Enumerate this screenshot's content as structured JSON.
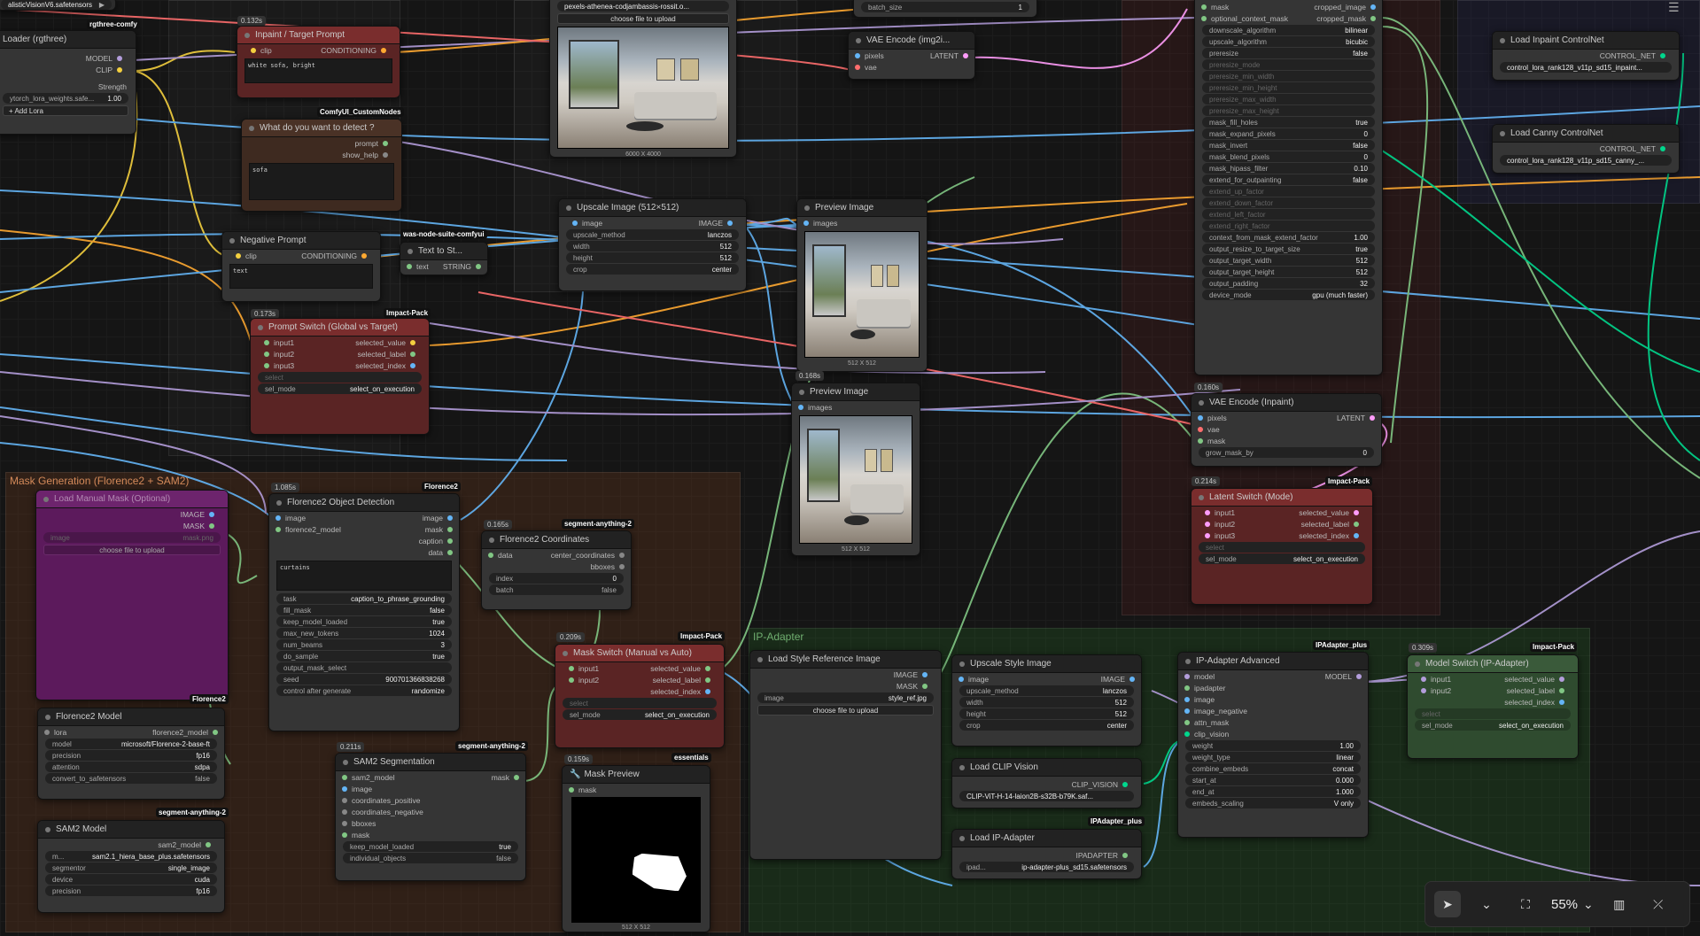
{
  "canvas": {
    "zoom": "55%"
  },
  "groups": {
    "mask_generation": "Mask Generation (Florence2 + SAM2)",
    "ip_adapter": "IP-Adapter"
  },
  "nodes": {
    "ckpt": {
      "value": "alisticVisionV6.safetensors"
    },
    "lora_loader": {
      "title": "Loader (rgthree)",
      "badge": "rgthree-comfy",
      "out_model": "MODEL",
      "out_clip": "CLIP",
      "strength_label": "Strength",
      "lora_name": "ytorch_lora_weights.safe...",
      "lora_strength": "1.00",
      "add_lora": "+ Add Lora"
    },
    "inpaint_prompt": {
      "time": "0.132s",
      "title": "Inpaint / Target Prompt",
      "in_clip": "clip",
      "out": "CONDITIONING",
      "text": "white sofa, bright",
      "badge": "ComfyUI_CustomNodes"
    },
    "detect_prompt": {
      "title": "What do you want to detect ?",
      "out_prompt": "prompt",
      "out_help": "show_help",
      "text": "sofa"
    },
    "negative": {
      "title": "Negative Prompt",
      "in_clip": "clip",
      "out": "CONDITIONING",
      "text": "text",
      "badge": "was-node-suite-comfyui"
    },
    "text_to_string": {
      "title": "Text to St...",
      "in": "text",
      "out": "STRING"
    },
    "prompt_switch": {
      "time": "0.173s",
      "badge": "Impact-Pack",
      "title": "Prompt Switch (Global vs Target)",
      "in1": "input1",
      "in2": "input2",
      "in3": "input3",
      "out1": "selected_value",
      "out2": "selected_label",
      "out3": "selected_index",
      "select": "select",
      "sel_mode": "sel_mode",
      "sel_mode_val": "select_on_execution"
    },
    "load_image": {
      "file": "pexels-athenea-codjambassis-rossit.o...",
      "choose": "choose file to upload",
      "dims": "6000 X 4000"
    },
    "upscale_image": {
      "title": "Upscale Image (512×512)",
      "in": "image",
      "out": "IMAGE",
      "method": "upscale_method",
      "method_val": "lanczos",
      "width": "width",
      "width_val": "512",
      "height": "height",
      "height_val": "512",
      "crop": "crop",
      "crop_val": "center"
    },
    "preview1": {
      "title": "Preview Image",
      "in": "images",
      "dims": "512 X 512"
    },
    "preview2": {
      "time": "0.168s",
      "title": "Preview Image",
      "in": "images",
      "dims": "512 X 512"
    },
    "batch": {
      "label": "batch_size",
      "value": "1"
    },
    "vae_encode": {
      "title": "VAE Encode (img2i...",
      "in1": "pixels",
      "in2": "vae",
      "out": "LATENT"
    },
    "crop_node": {
      "in1": "mask",
      "in2": "optional_context_mask",
      "out1": "cropped_image",
      "out2": "cropped_mask",
      "rows": [
        [
          "downscale_algorithm",
          "bilinear"
        ],
        [
          "upscale_algorithm",
          "bicubic"
        ],
        [
          "preresize",
          "false"
        ],
        [
          "preresize_mode",
          ""
        ],
        [
          "preresize_min_width",
          ""
        ],
        [
          "preresize_min_height",
          ""
        ],
        [
          "preresize_max_width",
          ""
        ],
        [
          "preresize_max_height",
          ""
        ],
        [
          "mask_fill_holes",
          "true"
        ],
        [
          "mask_expand_pixels",
          "0"
        ],
        [
          "mask_invert",
          "false"
        ],
        [
          "mask_blend_pixels",
          "0"
        ],
        [
          "mask_hipass_filter",
          "0.10"
        ],
        [
          "extend_for_outpainting",
          "false"
        ],
        [
          "extend_up_factor",
          ""
        ],
        [
          "extend_down_factor",
          ""
        ],
        [
          "extend_left_factor",
          ""
        ],
        [
          "extend_right_factor",
          ""
        ],
        [
          "context_from_mask_extend_factor",
          "1.00"
        ],
        [
          "output_resize_to_target_size",
          "true"
        ],
        [
          "output_target_width",
          "512"
        ],
        [
          "output_target_height",
          "512"
        ],
        [
          "output_padding",
          "32"
        ],
        [
          "device_mode",
          "gpu (much faster)"
        ]
      ]
    },
    "vae_inpaint": {
      "time": "0.160s",
      "title": "VAE Encode (Inpaint)",
      "in1": "pixels",
      "in2": "vae",
      "in3": "mask",
      "out": "LATENT",
      "grow": "grow_mask_by",
      "grow_val": "0"
    },
    "latent_switch": {
      "time": "0.214s",
      "badge": "Impact-Pack",
      "title": "Latent Switch (Mode)",
      "in1": "input1",
      "in2": "input2",
      "in3": "input3",
      "out1": "selected_value",
      "out2": "selected_label",
      "out3": "selected_index",
      "select": "select",
      "sel_mode": "sel_mode",
      "sel_mode_val": "select_on_execution"
    },
    "inpaint_cn": {
      "title": "Load Inpaint ControlNet",
      "out": "CONTROL_NET",
      "value": "control_lora_rank128_v11p_sd15_inpaint..."
    },
    "canny_cn": {
      "title": "Load Canny ControlNet",
      "out": "CONTROL_NET",
      "value": "control_lora_rank128_v11p_sd15_canny_..."
    },
    "manual_mask": {
      "title": "Load Manual Mask (Optional)",
      "out1": "IMAGE",
      "out2": "MASK",
      "image": "image",
      "image_val": "mask.png",
      "choose": "choose file to upload",
      "badge": "Florence2"
    },
    "florence_model": {
      "title": "Florence2 Model",
      "in": "lora",
      "out": "florence2_model",
      "model": "model",
      "model_val": "microsoft/Florence-2-base-ft",
      "precision": "precision",
      "precision_val": "fp16",
      "attention": "attention",
      "attention_val": "sdpa",
      "convert": "convert_to_safetensors",
      "convert_val": "false"
    },
    "florence_detect": {
      "time": "1.085s",
      "badge": "Florence2",
      "title": "Florence2 Object Detection",
      "in1": "image",
      "in2": "florence2_model",
      "out1": "image",
      "out2": "mask",
      "out3": "caption",
      "out4": "data",
      "text": "curtains",
      "rows": [
        [
          "task",
          "caption_to_phrase_grounding"
        ],
        [
          "fill_mask",
          "false"
        ],
        [
          "keep_model_loaded",
          "true"
        ],
        [
          "max_new_tokens",
          "1024"
        ],
        [
          "num_beams",
          "3"
        ],
        [
          "do_sample",
          "true"
        ],
        [
          "output_mask_select",
          ""
        ],
        [
          "seed",
          "900701366838268"
        ],
        [
          "control after generate",
          "randomize"
        ]
      ]
    },
    "florence_coords": {
      "time": "0.165s",
      "badge": "segment-anything-2",
      "title": "Florence2 Coordinates",
      "in": "data",
      "out1": "center_coordinates",
      "out2": "bboxes",
      "index": "index",
      "index_val": "0",
      "batch": "batch",
      "batch_val": "false"
    },
    "sam2_model": {
      "badge": "segment-anything-2",
      "title": "SAM2 Model",
      "out": "sam2_model",
      "model": "m...",
      "model_val": "sam2.1_hiera_base_plus.safetensors",
      "segmentor": "segmentor",
      "segmentor_val": "single_image",
      "device": "device",
      "device_val": "cuda",
      "precision": "precision",
      "precision_val": "fp16"
    },
    "sam2_seg": {
      "time": "0.211s",
      "badge": "segment-anything-2",
      "title": "SAM2 Segmentation",
      "ins": [
        "sam2_model",
        "image",
        "coordinates_positive",
        "coordinates_negative",
        "bboxes",
        "mask"
      ],
      "out": "mask",
      "keep": "keep_model_loaded",
      "keep_val": "true",
      "indiv": "individual_objects",
      "indiv_val": "false"
    },
    "mask_switch": {
      "time": "0.209s",
      "badge": "Impact-Pack",
      "title": "Mask Switch (Manual vs Auto)",
      "in1": "input1",
      "in2": "input2",
      "out1": "selected_value",
      "out2": "selected_label",
      "out3": "selected_index",
      "select": "select",
      "sel_mode": "sel_mode",
      "sel_mode_val": "select_on_execution"
    },
    "mask_preview": {
      "time": "0.159s",
      "badge": "essentials",
      "title": "Mask Preview",
      "in": "mask",
      "dims": "512 X 512"
    },
    "style_ref": {
      "title": "Load Style Reference Image",
      "out1": "IMAGE",
      "out2": "MASK",
      "image": "image",
      "image_val": "style_ref.jpg",
      "choose": "choose file to upload"
    },
    "upscale_style": {
      "title": "Upscale Style Image",
      "in": "image",
      "out": "IMAGE",
      "method": "upscale_method",
      "method_val": "lanczos",
      "width": "width",
      "width_val": "512",
      "height": "height",
      "height_val": "512",
      "crop": "crop",
      "crop_val": "center"
    },
    "clip_vision": {
      "title": "Load CLIP Vision",
      "out": "CLIP_VISION",
      "value": "CLIP-ViT-H-14-laion2B-s32B-b79K.saf..."
    },
    "ipa_loader": {
      "badge": "IPAdapter_plus",
      "title": "Load IP-Adapter",
      "out": "IPADAPTER",
      "label": "ipad...",
      "value": "ip-adapter-plus_sd15.safetensors"
    },
    "ipa_adv": {
      "badge": "IPAdapter_plus",
      "title": "IP-Adapter Advanced",
      "ins": [
        "model",
        "ipadapter",
        "image",
        "image_negative",
        "attn_mask",
        "clip_vision"
      ],
      "out": "MODEL",
      "rows": [
        [
          "weight",
          "1.00"
        ],
        [
          "weight_type",
          "linear"
        ],
        [
          "combine_embeds",
          "concat"
        ],
        [
          "start_at",
          "0.000"
        ],
        [
          "end_at",
          "1.000"
        ],
        [
          "embeds_scaling",
          "V only"
        ]
      ]
    },
    "model_switch": {
      "time": "0.309s",
      "badge": "Impact-Pack",
      "title": "Model Switch (IP-Adapter)",
      "in1": "input1",
      "in2": "input2",
      "out1": "selected_value",
      "out2": "selected_label",
      "out3": "selected_index",
      "select": "select",
      "sel_mode": "sel_mode",
      "sel_mode_val": "select_on_execution"
    }
  },
  "colors": {
    "clip": "#f4d03f",
    "model": "#b39ddb",
    "conditioning": "#ffa931",
    "image": "#64b5f6",
    "mask": "#81c784",
    "latent": "#ff9cf9",
    "vae": "#ff6e6e",
    "string": "#81c784",
    "control_net": "#00d78d"
  }
}
